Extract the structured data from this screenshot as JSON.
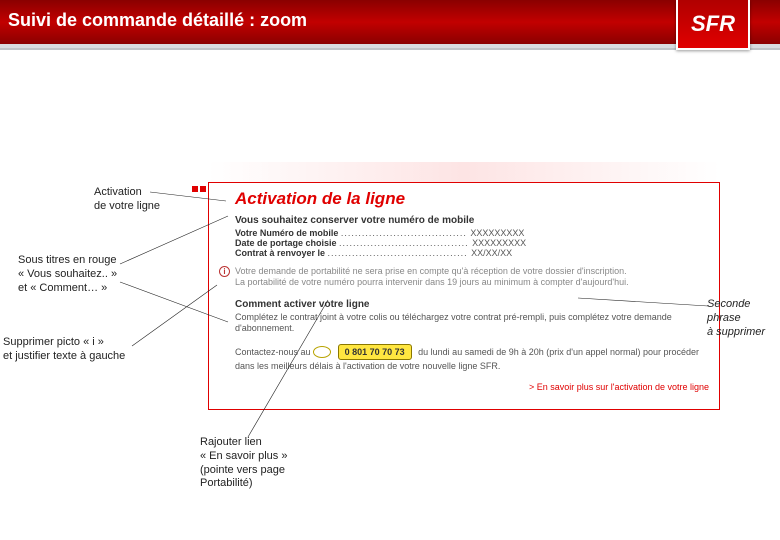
{
  "header": {
    "title": "Suivi de commande détaillé : zoom",
    "logo": "SFR"
  },
  "panel": {
    "title": "Activation de la ligne",
    "subtitle1": "Vous souhaitez conserver votre numéro de mobile",
    "rows": {
      "r1_label": "Votre Numéro de mobile",
      "r1_value": "XXXXXXXXX",
      "r2_label": "Date de portage choisie",
      "r2_value": "XXXXXXXXX",
      "r3_label": "Contrat à renvoyer le",
      "r3_value": "XX/XX/XX"
    },
    "info1": "Votre demande de portabilité ne sera prise en compte qu'à réception de votre dossier d'inscription.",
    "info2": "La portabilité de votre numéro pourra intervenir dans 19 jours au minimum à compter d'aujourd'hui.",
    "subtitle2": "Comment activer votre ligne",
    "activate_line": "Complétez le contrat joint à votre colis ou téléchargez votre contrat pré-rempli, puis complétez votre demande d'abonnement.",
    "contact_pre": "Contactez-nous au",
    "phone": "0 801 70 70 73",
    "contact_post": "du lundi au samedi de 9h à 20h (prix d'un appel normal) pour procéder dans les meilleurs délais à l'activation de votre nouvelle ligne SFR.",
    "learn_more": "> En savoir plus sur l'activation de votre ligne"
  },
  "annotations": {
    "a1": "Activation\nde votre ligne",
    "a2": "Sous titres en rouge\n« Vous souhaitez.. »\net « Comment… »",
    "a3": "Supprimer picto « i »\net justifier texte à gauche",
    "a4": "Seconde phrase\nà supprimer",
    "a5": "Rajouter lien\n« En savoir plus »\n(pointe vers page\nPortabilité)"
  }
}
